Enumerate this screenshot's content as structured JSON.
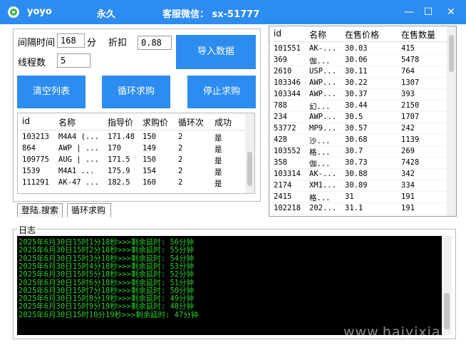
{
  "title": {
    "app": "yoyo",
    "license": "永久",
    "customer_service": "客服微信： sx-51777"
  },
  "window_controls": {
    "minimize": "—",
    "maximize": "☐",
    "close": "✕"
  },
  "settings": {
    "interval_label": "间隔时间",
    "interval_value": "168",
    "interval_unit": "分",
    "discount_label": "折扣",
    "discount_value": "0.88",
    "threads_label": "线程数",
    "threads_value": "5",
    "import_button": "导入数据"
  },
  "actions": {
    "clear_list": "清空列表",
    "loop_buy": "循环求购",
    "stop_buy": "停止求购"
  },
  "buy_table": {
    "columns": [
      "id",
      "名称",
      "指导价",
      "求购价",
      "循环次",
      "成功"
    ],
    "rows": [
      [
        "103213",
        "M4A4 (...",
        "171.48",
        "150",
        "2",
        "是"
      ],
      [
        "864",
        "AWP | ...",
        "170",
        "149",
        "2",
        "是"
      ],
      [
        "109775",
        "AUG | ...",
        "171.5",
        "150",
        "2",
        "是"
      ],
      [
        "1539",
        "M4A1 ...",
        "175.9",
        "154",
        "2",
        "是"
      ],
      [
        "111291",
        "AK-47 ...",
        "182.5",
        "160",
        "2",
        "是"
      ]
    ]
  },
  "tabs": [
    "登陆.搜索",
    "循环求购"
  ],
  "market_table": {
    "columns": [
      "id",
      "名称",
      "在售价格",
      "在售数量"
    ],
    "rows": [
      [
        "101551",
        "AK-...",
        "30.03",
        "415"
      ],
      [
        "369",
        "伽...",
        "30.06",
        "5478"
      ],
      [
        "2610",
        "USP...",
        "30.11",
        "764"
      ],
      [
        "103346",
        "AWP...",
        "30.22",
        "1307"
      ],
      [
        "103344",
        "AWP...",
        "30.37",
        "393"
      ],
      [
        "788",
        "幻...",
        "30.44",
        "2150"
      ],
      [
        "234",
        "AWP...",
        "30.5",
        "1707"
      ],
      [
        "53772",
        "MP9...",
        "30.57",
        "242"
      ],
      [
        "428",
        "沙...",
        "30.68",
        "1139"
      ],
      [
        "103552",
        "格...",
        "30.7",
        "269"
      ],
      [
        "358",
        "伽...",
        "30.73",
        "7428"
      ],
      [
        "103314",
        "AK-...",
        "30.88",
        "342"
      ],
      [
        "2174",
        "XM1...",
        "30.89",
        "334"
      ],
      [
        "2415",
        "格...",
        "31",
        "191"
      ],
      [
        "102218",
        "202...",
        "31.1",
        "191"
      ]
    ]
  },
  "log": {
    "label": "日志",
    "lines": [
      "2025年6月30日15时1分18秒>>>剩余延时: 56分钟",
      "2025年6月30日15时2分18秒>>>剩余延时: 55分钟",
      "2025年6月30日15时3分18秒>>>剩余延时: 54分钟",
      "2025年6月30日15时4分18秒>>>剩余延时: 53分钟",
      "2025年6月30日15时5分18秒>>>剩余延时: 52分钟",
      "2025年6月30日15时6分18秒>>>剩余延时: 51分钟",
      "2025年6月30日15时7分18秒>>>剩余延时: 50分钟",
      "2025年6月30日15时8分19秒>>>剩余延时: 49分钟",
      "2025年6月30日15时9分19秒>>>剩余延时: 48分钟",
      "2025年6月30日15时10分19秒>>>剩余延时: 47分钟"
    ]
  },
  "watermark": "www.haiyixian.com"
}
